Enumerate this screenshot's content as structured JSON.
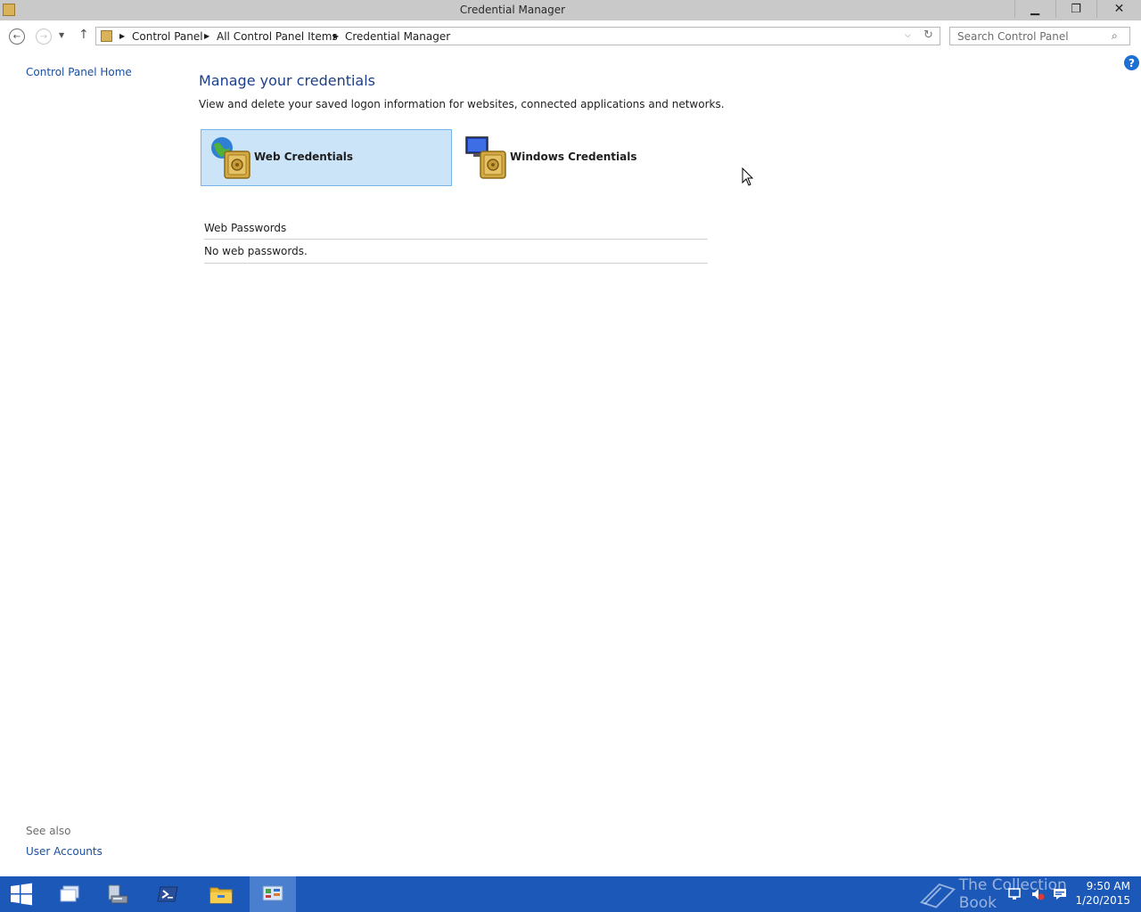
{
  "window": {
    "title": "Credential Manager",
    "minimize_glyph": "▁",
    "maximize_glyph": "❐",
    "close_glyph": "✕"
  },
  "nav": {
    "breadcrumbs": [
      "Control Panel",
      "All Control Panel Items",
      "Credential Manager"
    ],
    "search_placeholder": "Search Control Panel"
  },
  "left_pane": {
    "home_link": "Control Panel Home",
    "see_also_label": "See also",
    "see_also_links": [
      "User Accounts"
    ]
  },
  "main": {
    "title": "Manage your credentials",
    "description": "View and delete your saved logon information for websites, connected applications and networks.",
    "tiles": [
      {
        "label": "Web Credentials",
        "selected": true
      },
      {
        "label": "Windows Credentials",
        "selected": false
      }
    ],
    "section": {
      "header": "Web Passwords",
      "empty_text": "No web passwords."
    }
  },
  "taskbar": {
    "watermark": "The Collection Book",
    "time": "9:50 AM",
    "date": "1/20/2015"
  },
  "colors": {
    "link": "#1a4fa0",
    "title": "#1d3f8a",
    "selected_tile": "#cce4f7",
    "taskbar": "#1b58b8"
  },
  "icons": {
    "help": "question-mark-icon",
    "web_credentials": "globe-vault-icon",
    "windows_credentials": "monitor-vault-icon"
  }
}
